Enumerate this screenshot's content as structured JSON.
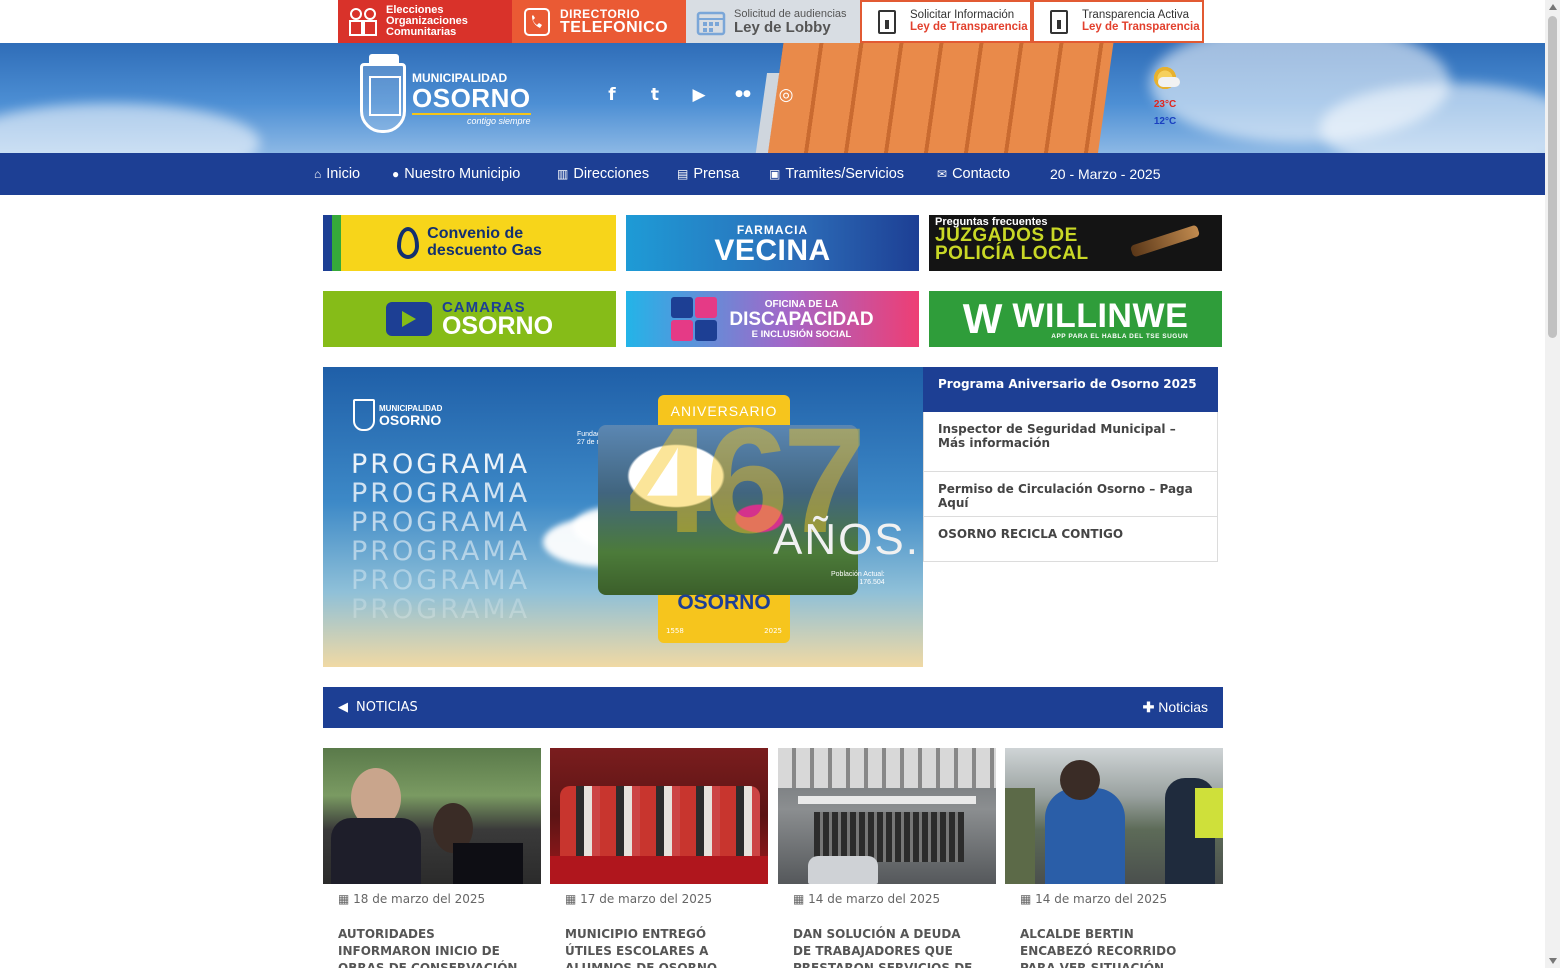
{
  "top_banners": {
    "elecciones": {
      "line1": "Elecciones",
      "line2": "Organizaciones",
      "line3": "Comunitarias"
    },
    "directorio": {
      "line1": "DIRECTORIO",
      "line2": "TELEFONICO"
    },
    "lobby": {
      "line1": "Solicitud de audiencias",
      "line2": "Ley de Lobby"
    },
    "solicitar": {
      "line1": "Solicitar Información",
      "line2": "Ley de Transparencia"
    },
    "transparencia": {
      "line1": "Transparencia Activa",
      "line2": "Ley de Transparencia"
    }
  },
  "logo": {
    "line1": "MUNICIPALIDAD",
    "line2": "OSORNO",
    "tagline": "contigo siempre"
  },
  "social": {
    "facebook": "f",
    "twitter": "t",
    "youtube": "▶",
    "flickr": "●●",
    "instagram": "◎"
  },
  "weather": {
    "high": "23°C",
    "low": "12°C",
    "icon": "partly-cloudy-icon"
  },
  "nav": {
    "items": [
      {
        "icon": "home-icon",
        "glyph": "⌂",
        "label": "Inicio"
      },
      {
        "icon": "user-icon",
        "glyph": "●",
        "label": "Nuestro Municipio"
      },
      {
        "icon": "building-icon",
        "glyph": "▥",
        "label": "Direcciones"
      },
      {
        "icon": "newspaper-icon",
        "glyph": "▤",
        "label": "Prensa"
      },
      {
        "icon": "briefcase-icon",
        "glyph": "▣",
        "label": "Tramites/Servicios"
      },
      {
        "icon": "envelope-icon",
        "glyph": "✉",
        "label": "Contacto"
      }
    ],
    "date": "20 - Marzo - 2025"
  },
  "banners": {
    "gas": {
      "line1": "Convenio de",
      "line2": "descuento Gas"
    },
    "farmacia": {
      "line1": "FARMACIA",
      "line2": "VECINA"
    },
    "jpl": {
      "line0": "Preguntas frecuentes",
      "line1": "JUZGADOS DE",
      "line2": "POLICÍA LOCAL"
    },
    "camaras": {
      "line1": "CAMARAS",
      "line2": "OSORNO"
    },
    "discapacidad": {
      "line1": "OFICINA DE LA",
      "line2": "DISCAPACIDAD",
      "line3": "E INCLUSIÓN SOCIAL"
    },
    "willinwe": {
      "mark": "W",
      "line1": "WILLINWE",
      "line2": "APP PARA EL HABLA DEL TSE SUGUN"
    }
  },
  "slider": {
    "logo_line1": "MUNICIPALIDAD",
    "logo_line2": "OSORNO",
    "programa": "PROGRAMA",
    "aniversario": "ANIVERSARIO",
    "number": "467",
    "suffix": "AÑOS.",
    "city": "OSORNO",
    "year_start": "1558",
    "year_end": "2025",
    "fundacion_label": "Fundación:",
    "fundacion_date": "27 de marzo",
    "poblacion_label": "Población Actual:",
    "poblacion_value": "176.504"
  },
  "slider_list": [
    {
      "title": "Programa Aniversario de Osorno 2025",
      "active": true
    },
    {
      "title": "Inspector de Seguridad Municipal – Más información",
      "active": false
    },
    {
      "title": "Permiso de Circulación Osorno – Paga Aquí",
      "active": false
    },
    {
      "title": "OSORNO RECICLA CONTIGO",
      "active": false
    }
  ],
  "news_bar": {
    "title": "NOTICIAS",
    "more_label": "Noticias"
  },
  "news": [
    {
      "date": "18 de marzo del 2025",
      "title": "AUTORIDADES INFORMARON INICIO DE OBRAS DE CONSERVACIÓN DE CAMINO"
    },
    {
      "date": "17 de marzo del 2025",
      "title": "MUNICIPIO ENTREGÓ ÚTILES ESCOLARES A ALUMNOS DE OSORNO"
    },
    {
      "date": "14 de marzo del 2025",
      "title": "DAN SOLUCIÓN A DEUDA DE TRABAJADORES QUE PRESTARON SERVICIOS DE"
    },
    {
      "date": "14 de marzo del 2025",
      "title": "ALCALDE BERTIN ENCABEZÓ RECORRIDO PARA VER SITUACIÓN ACTUAL DEL PRETIL"
    }
  ],
  "colors": {
    "brand_blue": "#1d3f94",
    "orange": "#ea5a34",
    "red": "#d9322a"
  }
}
